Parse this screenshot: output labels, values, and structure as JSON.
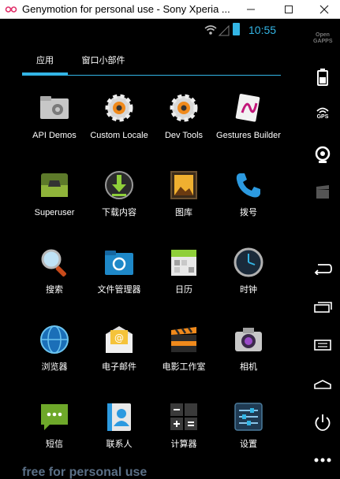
{
  "window": {
    "title": "Genymotion for personal use - Sony Xperia ...",
    "minimize": "—",
    "maximize": "☐",
    "close": "✕"
  },
  "status_bar": {
    "time": "10:55"
  },
  "tabs": [
    {
      "label": "应用",
      "selected": true
    },
    {
      "label": "窗口小部件",
      "selected": false
    }
  ],
  "apps": [
    {
      "label": "API Demos",
      "icon": "folder-gear-icon"
    },
    {
      "label": "Custom Locale",
      "icon": "gear-orange-icon"
    },
    {
      "label": "Dev Tools",
      "icon": "gear-orange-icon"
    },
    {
      "label": "Gestures Builder",
      "icon": "gestures-icon"
    },
    {
      "label": "Superuser",
      "icon": "superuser-icon"
    },
    {
      "label": "下载内容",
      "icon": "download-icon"
    },
    {
      "label": "图库",
      "icon": "gallery-icon"
    },
    {
      "label": "拨号",
      "icon": "phone-icon"
    },
    {
      "label": "搜索",
      "icon": "magnifier-icon"
    },
    {
      "label": "文件管理器",
      "icon": "file-manager-icon"
    },
    {
      "label": "日历",
      "icon": "calendar-icon"
    },
    {
      "label": "时钟",
      "icon": "clock-icon"
    },
    {
      "label": "浏览器",
      "icon": "globe-icon"
    },
    {
      "label": "电子邮件",
      "icon": "email-icon"
    },
    {
      "label": "电影工作室",
      "icon": "clapperboard-icon"
    },
    {
      "label": "相机",
      "icon": "camera-icon"
    },
    {
      "label": "短信",
      "icon": "sms-icon"
    },
    {
      "label": "联系人",
      "icon": "contacts-icon"
    },
    {
      "label": "计算器",
      "icon": "calculator-icon"
    },
    {
      "label": "设置",
      "icon": "settings-sliders-icon"
    }
  ],
  "watermark": "free for personal use",
  "toolbar": {
    "open_gapps": "Open GAPPS",
    "gps": "GPS"
  },
  "colors": {
    "accent": "#33b5e5",
    "watermark": "#5a6f86"
  }
}
